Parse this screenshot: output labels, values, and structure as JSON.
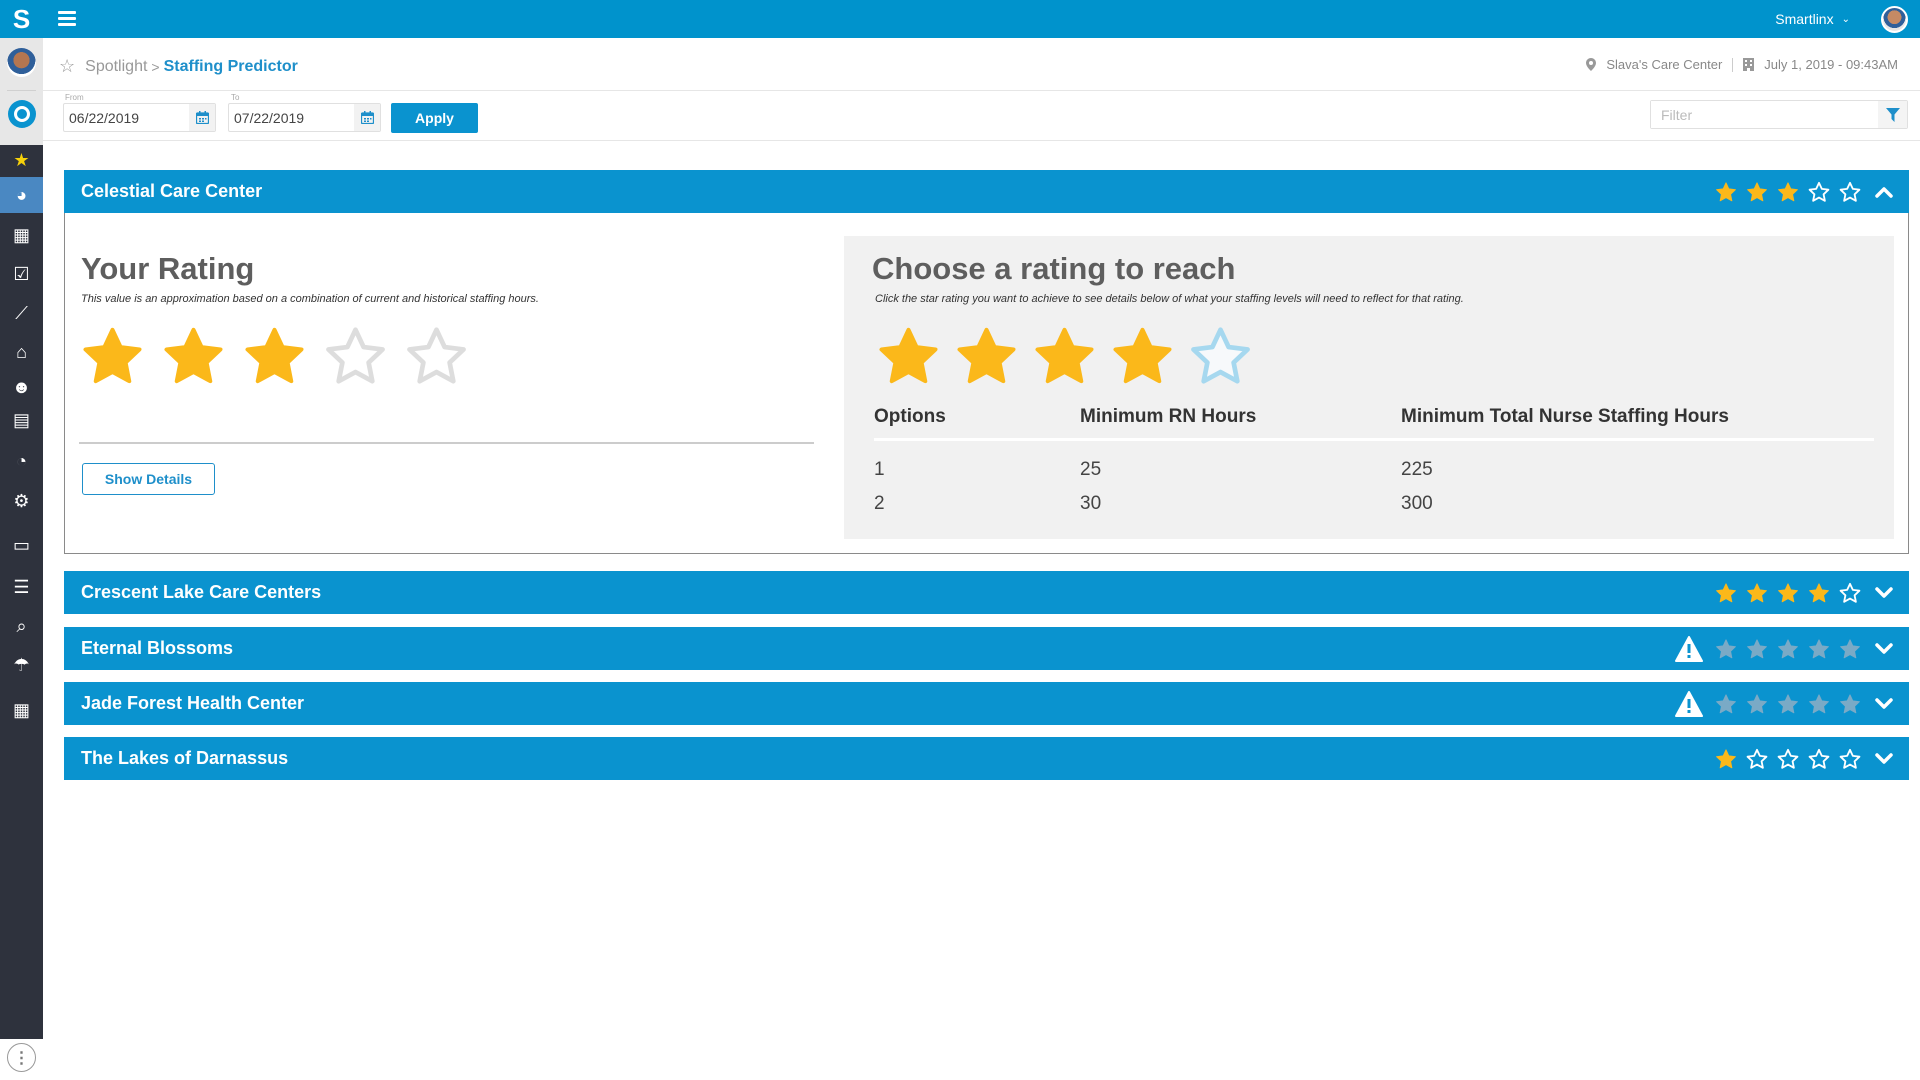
{
  "app": {
    "logo_letter": "S",
    "user_name": "Smartlinx"
  },
  "breadcrumb": {
    "parent": "Spotlight",
    "separator": ">",
    "current": "Staffing Predictor"
  },
  "context": {
    "location": "Slava's Care Center",
    "datetime": "July 1, 2019 - 09:43AM"
  },
  "filters": {
    "from_label": "From",
    "from_value": "06/22/2019",
    "to_label": "To",
    "to_value": "07/22/2019",
    "apply_label": "Apply",
    "filter_placeholder": "Filter"
  },
  "sidebar": {
    "items": [
      {
        "icon": "star-icon",
        "glyph": "★",
        "active": false
      },
      {
        "icon": "pie-chart-icon",
        "glyph": "◕",
        "active": true
      },
      {
        "icon": "calendar-icon",
        "glyph": "▦",
        "active": false
      },
      {
        "icon": "calendar-check-icon",
        "glyph": "☑",
        "active": false
      },
      {
        "icon": "line-chart-icon",
        "glyph": "⟋",
        "active": false
      },
      {
        "icon": "bank-icon",
        "glyph": "⌂",
        "active": false
      },
      {
        "icon": "users-icon",
        "glyph": "☻",
        "active": false
      },
      {
        "icon": "badge-icon",
        "glyph": "▤",
        "active": false
      },
      {
        "icon": "report-icon",
        "glyph": "◔",
        "active": false
      },
      {
        "icon": "settings-icon",
        "glyph": "⚙",
        "active": false
      },
      {
        "icon": "id-card-icon",
        "glyph": "▭",
        "active": false
      },
      {
        "icon": "list-icon",
        "glyph": "☰",
        "active": false
      },
      {
        "icon": "search-user-icon",
        "glyph": "⌕",
        "active": false
      },
      {
        "icon": "umbrella-icon",
        "glyph": "☂",
        "active": false
      },
      {
        "icon": "grid-icon",
        "glyph": "▦",
        "active": false
      }
    ]
  },
  "facilities": [
    {
      "name": "Celestial Care Center",
      "rating": 3,
      "warning": false,
      "expanded": true
    },
    {
      "name": "Crescent Lake Care Centers",
      "rating": 4,
      "warning": false,
      "expanded": false
    },
    {
      "name": "Eternal Blossoms",
      "rating": 0,
      "warning": true,
      "expanded": false
    },
    {
      "name": "Jade Forest Health Center",
      "rating": 0,
      "warning": true,
      "expanded": false
    },
    {
      "name": "The Lakes of Darnassus",
      "rating": 1,
      "warning": false,
      "expanded": false
    }
  ],
  "detail": {
    "your_rating_title": "Your Rating",
    "your_rating_subtitle": "This value is an approximation based on a combination of current and historical staffing hours.",
    "your_rating_value": 3,
    "show_details_label": "Show Details",
    "reach_title": "Choose a rating to reach",
    "reach_subtitle": "Click the star rating you want to achieve to see details below of what your staffing levels will need to reflect for that rating.",
    "reach_selected": 4,
    "table": {
      "headers": [
        "Options",
        "Minimum RN Hours",
        "Minimum Total Nurse Staffing Hours"
      ],
      "rows": [
        [
          "1",
          "25",
          "225"
        ],
        [
          "2",
          "30",
          "300"
        ]
      ]
    }
  },
  "colors": {
    "brand_blue": "#0a93cf",
    "star_gold": "#fbb81a",
    "star_empty_light": "#dddddd",
    "star_target_outline": "#a6d8ef",
    "star_disabled": "#7aaac6",
    "sidebar_dark": "#2e323d"
  }
}
